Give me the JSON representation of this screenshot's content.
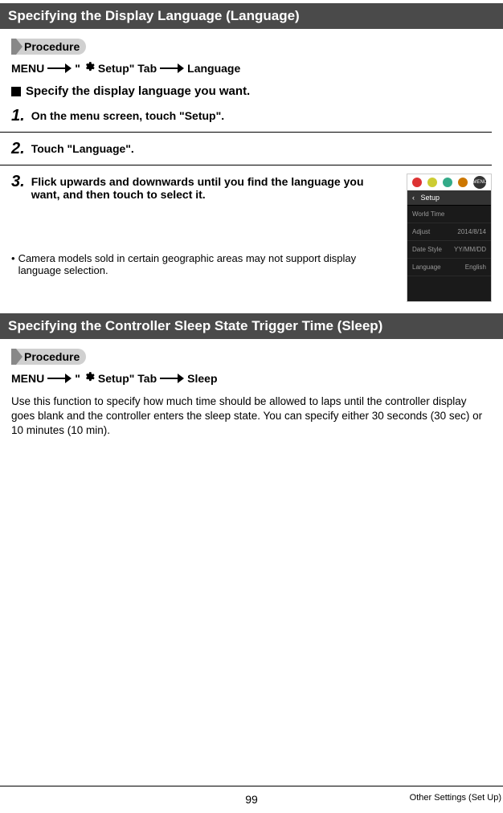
{
  "section1": {
    "title": "Specifying the Display Language (Language)",
    "procedure_label": "Procedure",
    "menu_label": "MENU",
    "setup_tab": "Setup\" Tab",
    "quote_open": "\"",
    "language": "Language",
    "specify_step": "Specify the display language you want.",
    "step1": "On the menu screen, touch \"Setup\".",
    "step2": "Touch \"Language\".",
    "step3": "Flick upwards and downwards until you find the language you want, and then touch to select it.",
    "note_bullet": "•",
    "note": "Camera models sold in certain geographic areas may not support display language selection."
  },
  "screenshot": {
    "setup": "Setup",
    "back": "‹",
    "rows": [
      {
        "label": "World Time",
        "value": ""
      },
      {
        "label": "Adjust",
        "value": "2014/8/14"
      },
      {
        "label": "Date Style",
        "value": "YY/MM/DD"
      },
      {
        "label": "Language",
        "value": "English"
      }
    ]
  },
  "section2": {
    "title": "Specifying the Controller Sleep State Trigger Time (Sleep)",
    "procedure_label": "Procedure",
    "menu_label": "MENU",
    "setup_tab": "Setup\" Tab",
    "quote_open": "\"",
    "sleep": "Sleep",
    "body": "Use this function to specify how much time should be allowed to laps until the controller display goes blank and the controller enters the sleep state. You can specify either 30 seconds (30 sec) or 10 minutes (10 min)."
  },
  "footer": {
    "page": "99",
    "section": "Other Settings (Set Up)"
  },
  "nums": {
    "n1": "1.",
    "n2": "2.",
    "n3": "3."
  }
}
